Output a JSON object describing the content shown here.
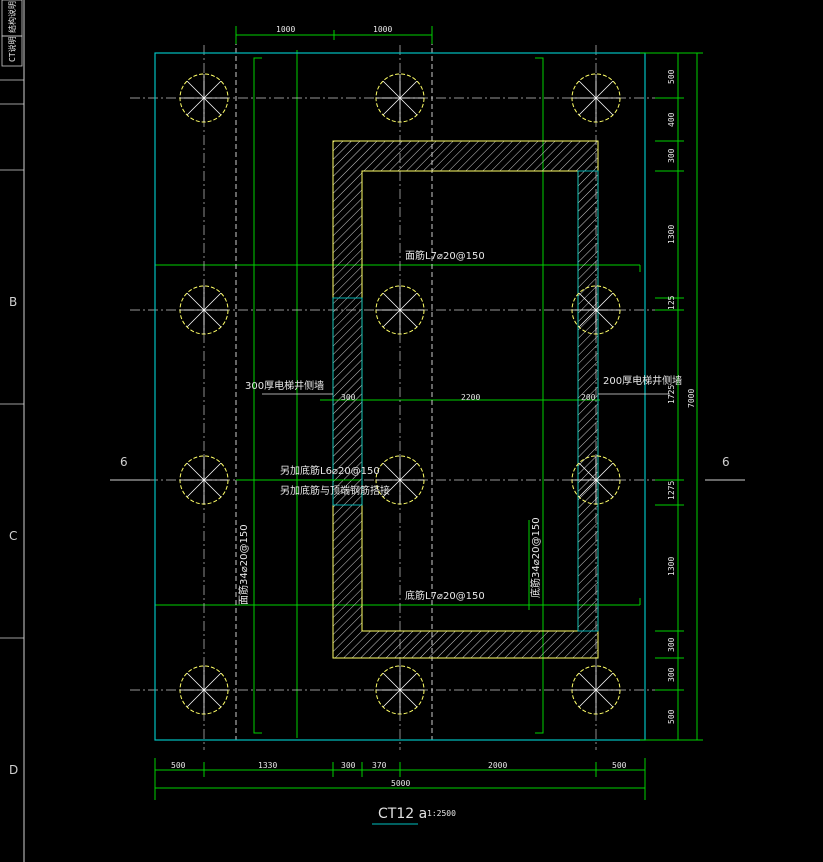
{
  "side_strip": {
    "rotated_label_1": "结构说明",
    "rotated_label_2": "CT说明",
    "row_letters": [
      "B",
      "C",
      "D"
    ]
  },
  "top_dims": [
    "1000",
    "1000"
  ],
  "right_dims": [
    "500",
    "400",
    "300",
    "1300",
    "125",
    "1725",
    "1275",
    "1300",
    "300",
    "300",
    "500"
  ],
  "right_total": "7000",
  "inner_dims": {
    "left_wall": "300",
    "span": "2200",
    "right_wall": "200"
  },
  "bottom_dims": [
    "500",
    "1330",
    "300",
    "370",
    "2000",
    "500"
  ],
  "bottom_total": "5000",
  "annotations": {
    "top_rebar": "面筋L7⌀20@150",
    "bottom_rebar": "底筋L7⌀20@150",
    "left_vertical_rebar": "面筋34⌀20@150",
    "right_vertical_rebar": "底筋34⌀20@150",
    "wall_300": "300厚电梯井侧墙",
    "wall_200": "200厚电梯井侧墙",
    "extra_rebar_1": "另加底筋L6⌀20@150",
    "extra_rebar_2": "另加底筋与顶端钢筋搭接"
  },
  "section_marks": {
    "left": "6",
    "right": "6"
  },
  "title": {
    "name": "CT12 a",
    "scale": "1:2500"
  },
  "colors": {
    "background": "#000000",
    "outline": "#00c0c0",
    "dimension": "#00d000",
    "pile": "#ffff66",
    "hatch": "#d8d8d8",
    "text": "#e8e8e8"
  }
}
